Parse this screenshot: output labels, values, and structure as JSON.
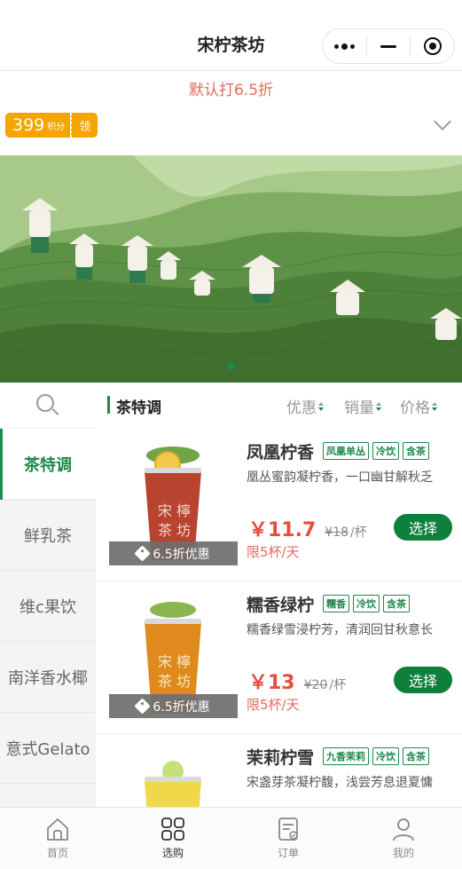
{
  "header": {
    "title": "宋柠茶坊"
  },
  "store": {
    "discount_text": "默认打6.5折",
    "points_value": "399",
    "points_unit": "积分",
    "claim_label": "领"
  },
  "categories": [
    {
      "label": "茶特调",
      "active": true
    },
    {
      "label": "鲜乳茶",
      "active": false
    },
    {
      "label": "维c果饮",
      "active": false
    },
    {
      "label": "南洋香水椰",
      "active": false
    },
    {
      "label": "意式Gelato",
      "active": false
    }
  ],
  "section": {
    "title": "茶特调",
    "sorts": [
      "优惠",
      "销量",
      "价格"
    ]
  },
  "products": [
    {
      "name": "凤凰柠香",
      "tags": [
        "凤凰单丛",
        "冷饮",
        "含茶"
      ],
      "desc": "凰丛蜜韵凝柠香，一口幽甘解秋乏",
      "price": "￥11.7",
      "old_price": "¥18",
      "unit": "/杯",
      "limit": "限5杯/天",
      "promo": "6.5折优惠",
      "button": "选择",
      "cup_color": "#b8432f"
    },
    {
      "name": "糯香绿柠",
      "tags": [
        "糯香",
        "冷饮",
        "含茶"
      ],
      "desc": "糯香绿雪浸柠芳，清润回甘秋意长",
      "price": "￥13",
      "old_price": "¥20",
      "unit": "/杯",
      "limit": "限5杯/天",
      "promo": "6.5折优惠",
      "button": "选择",
      "cup_color": "#e08a1e"
    },
    {
      "name": "茉莉柠雪",
      "tags": [
        "九香茉莉",
        "冷饮",
        "含茶"
      ],
      "desc": "宋盏芽茶凝柠馥，浅尝芳息退夏慵",
      "cup_color": "#efd84a"
    }
  ],
  "tabs": [
    {
      "label": "首页",
      "icon": "home-icon"
    },
    {
      "label": "选购",
      "icon": "grid-icon"
    },
    {
      "label": "订单",
      "icon": "order-icon"
    },
    {
      "label": "我的",
      "icon": "user-icon"
    }
  ],
  "colors": {
    "brand_green": "#1d8a4a",
    "accent_red": "#e56a5f",
    "points_orange": "#f5a400"
  }
}
